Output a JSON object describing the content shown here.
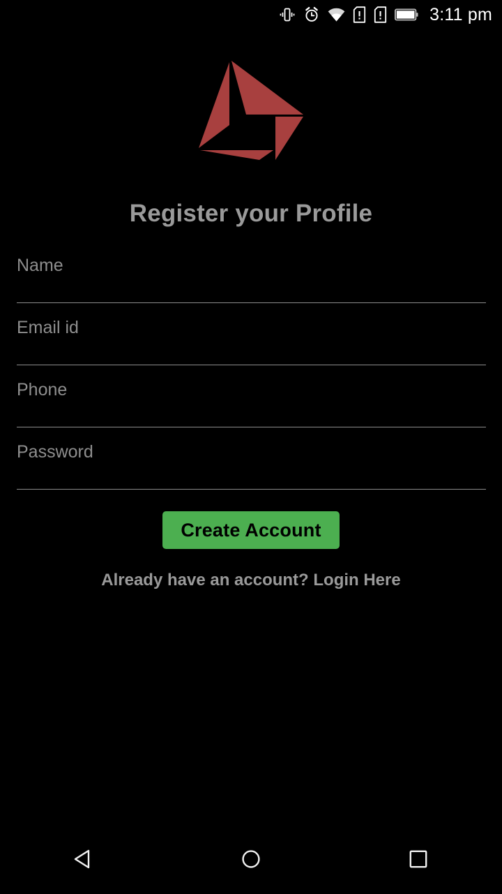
{
  "statusbar": {
    "time": "3:11 pm",
    "icons": [
      {
        "name": "vibrate-icon",
        "label": "vibrate"
      },
      {
        "name": "alarm-icon",
        "label": "alarm"
      },
      {
        "name": "wifi-icon",
        "label": "wifi"
      },
      {
        "name": "sim-card-1-alert-icon",
        "label": "sim 1 missing"
      },
      {
        "name": "sim-card-2-alert-icon",
        "label": "sim 2 missing"
      },
      {
        "name": "battery-full-icon",
        "label": "battery full"
      }
    ]
  },
  "logo": {
    "name": "app-logo-pinwheel",
    "color": "#A8403F"
  },
  "page": {
    "title": "Register your Profile"
  },
  "form": {
    "fields": [
      {
        "name": "name-input",
        "placeholder": "Name",
        "value": ""
      },
      {
        "name": "email-input",
        "placeholder": "Email id",
        "value": ""
      },
      {
        "name": "phone-input",
        "placeholder": "Phone",
        "value": ""
      },
      {
        "name": "password-input",
        "placeholder": "Password",
        "value": ""
      }
    ],
    "underline_color": "#8d8d8d"
  },
  "actions": {
    "create_account_label": "Create Account",
    "create_account_color": "#4CAF50",
    "login_prompt": "Already have an account? Login Here"
  },
  "navbar": {
    "back_label": "Back",
    "home_label": "Home",
    "recents_label": "Recent apps"
  }
}
